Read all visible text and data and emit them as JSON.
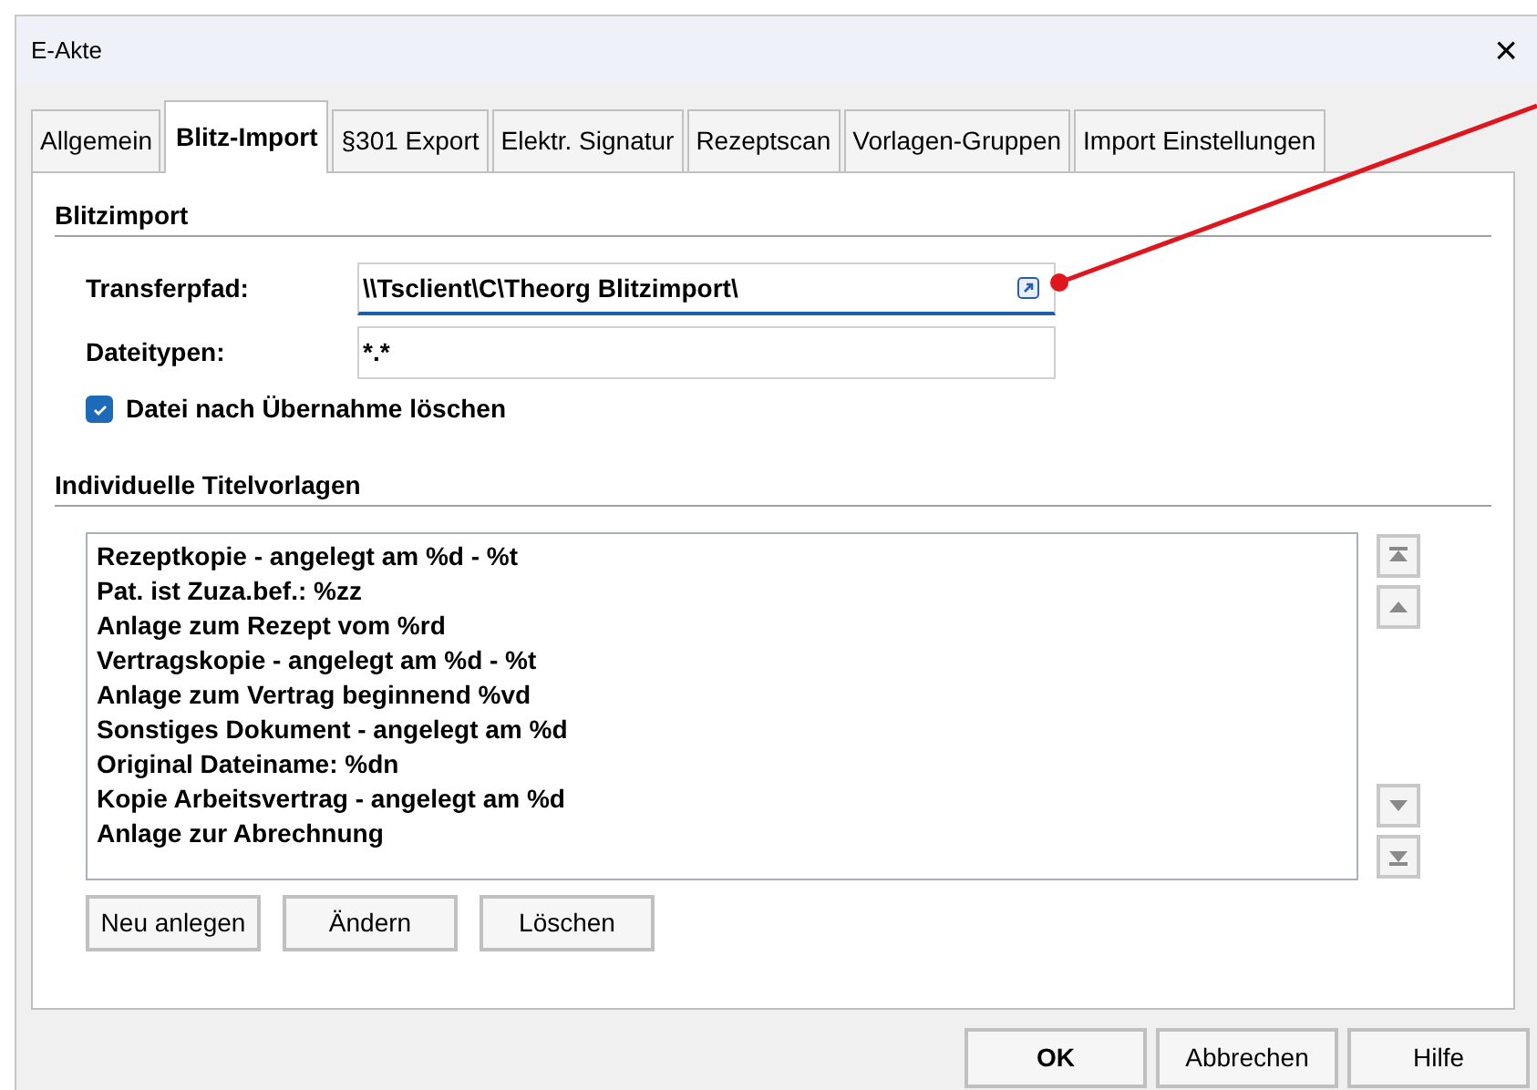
{
  "window": {
    "title": "E-Akte",
    "close": "×"
  },
  "tabs": [
    {
      "label": "Allgemein",
      "selected": false
    },
    {
      "label": "Blitz-Import",
      "selected": true
    },
    {
      "label": "§301 Export",
      "selected": false
    },
    {
      "label": "Elektr. Signatur",
      "selected": false
    },
    {
      "label": "Rezeptscan",
      "selected": false
    },
    {
      "label": "Vorlagen-Gruppen",
      "selected": false
    },
    {
      "label": "Import Einstellungen",
      "selected": false
    }
  ],
  "blitzimport": {
    "heading": "Blitzimport",
    "fields": [
      {
        "label": "Transferpfad:",
        "value": "\\\\Tsclient\\C\\Theorg Blitzimport\\",
        "focused": true,
        "browse": true
      },
      {
        "label": "Dateitypen:",
        "value": "*.*",
        "focused": false,
        "browse": false
      }
    ],
    "delete_after": {
      "label": "Datei nach Übernahme löschen",
      "checked": true
    }
  },
  "templates": {
    "heading": "Individuelle Titelvorlagen",
    "items": [
      "Rezeptkopie - angelegt am %d - %t",
      "Pat. ist Zuza.bef.: %zz",
      "Anlage zum Rezept vom %rd",
      "Vertragskopie - angelegt am %d - %t",
      "Anlage zum Vertrag beginnend %vd",
      "Sonstiges Dokument - angelegt am %d",
      "Original Dateiname: %dn",
      "Kopie Arbeitsvertrag - angelegt am %d",
      "Anlage zur Abrechnung"
    ],
    "buttons": [
      "Neu anlegen",
      "Ändern",
      "Löschen"
    ]
  },
  "footer_buttons": [
    {
      "label": "OK",
      "default": true
    },
    {
      "label": "Abbrechen",
      "default": false
    },
    {
      "label": "Hilfe",
      "default": false
    }
  ]
}
